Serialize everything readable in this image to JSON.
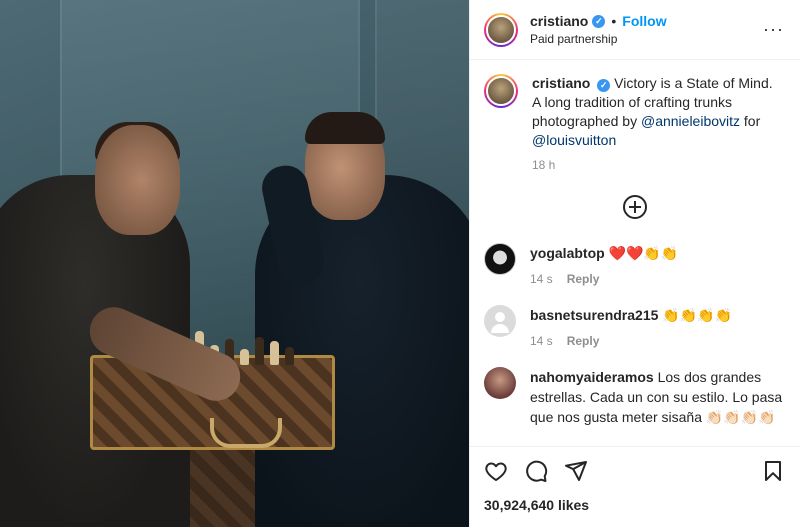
{
  "post": {
    "username": "cristiano",
    "follow_label": "Follow",
    "dot": "•",
    "subtitle": "Paid partnership",
    "more_label": "···",
    "caption": {
      "username": "cristiano",
      "text_1": "Victory is a State of Mind. A long tradition of crafting trunks photographed by ",
      "mention_1": "@annieleibovitz",
      "text_2": " for ",
      "mention_2": "@louisvuitton",
      "time": "18 h"
    },
    "comments": [
      {
        "username": "yogalabtop",
        "text": "❤️❤️👏👏",
        "time": "14 s",
        "reply": "Reply"
      },
      {
        "username": "basnetsurendra215",
        "text": "👏👏👏👏",
        "time": "14 s",
        "reply": "Reply"
      },
      {
        "username": "nahomyaideramos",
        "text": "Los dos grandes estrellas. Cada un con su estilo. Lo pasa que nos gusta meter sisaña 👏🏻👏🏻👏🏻👏🏻"
      }
    ],
    "likes": "30,924,640 likes"
  },
  "icons": {
    "like": "heart-icon",
    "comment": "comment-icon",
    "share": "share-icon",
    "save": "bookmark-icon",
    "load_more": "plus-circle-icon",
    "verified": "verified-badge-icon"
  },
  "colors": {
    "link_blue": "#0095f6",
    "mention": "#00376b",
    "verified": "#3897f0",
    "muted": "#8e8e8e"
  }
}
